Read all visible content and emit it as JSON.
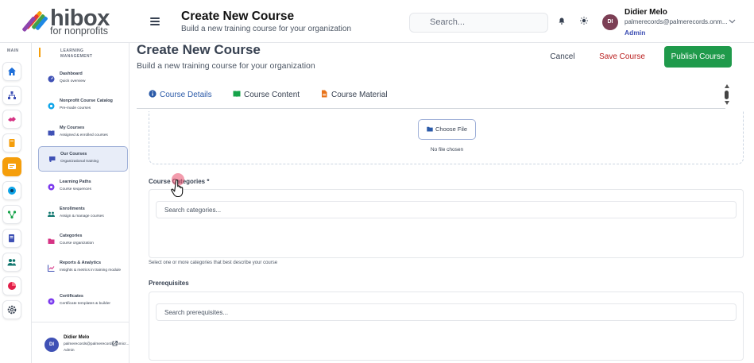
{
  "app": {
    "logo_word": "hibox",
    "logo_sub": "for nonprofits"
  },
  "header": {
    "title": "Create New Course",
    "subtitle": "Build a new training course for your organization",
    "search_placeholder": "Search...",
    "user": {
      "initials": "DI",
      "name": "Didier Melo",
      "email": "palmerecords@palmerecords.onm...",
      "role": "Admin"
    }
  },
  "rail": {
    "label": "MAIN"
  },
  "menu": {
    "label_line1": "LEARNING",
    "label_line2": "MANAGEMENT",
    "items": [
      {
        "title": "Dashboard",
        "desc": "Quick overview"
      },
      {
        "title": "Nonprofit Course Catalog",
        "desc": "Pre-made courses"
      },
      {
        "title": "My Courses",
        "desc": "Assigned & enrolled courses"
      },
      {
        "title": "Our Courses",
        "desc": "Organizational training"
      },
      {
        "title": "Learning Paths",
        "desc": "Course sequences"
      },
      {
        "title": "Enrollments",
        "desc": "Assign & manage courses"
      },
      {
        "title": "Categories",
        "desc": "Course organization"
      },
      {
        "title": "Reports & Analytics",
        "desc": "Insights & metrics in training module"
      },
      {
        "title": "Certificates",
        "desc": "Certificate templates & builder"
      }
    ],
    "footer": {
      "initials": "DI",
      "name": "Didier Melo",
      "email": "palmerecords@palmerecords.onmicr...",
      "role": "Admin"
    }
  },
  "page": {
    "title": "Create New Course",
    "subtitle": "Build a new training course for your organization",
    "actions": {
      "cancel": "Cancel",
      "save": "Save Course",
      "publish": "Publish Course"
    },
    "tabs": [
      {
        "label": "Course Details"
      },
      {
        "label": "Course Content"
      },
      {
        "label": "Course Material"
      }
    ],
    "upload": {
      "button": "Choose File",
      "status": "No file chosen"
    },
    "categories": {
      "label": "Course Categories *",
      "placeholder": "Search categories...",
      "hint": "Select one or more categories that best describe your course"
    },
    "prerequisites": {
      "label": "Prerequisites",
      "placeholder": "Search prerequisites..."
    }
  },
  "colors": {
    "accent": "#f59e0b",
    "primary": "#2b5aa8",
    "publish": "#1f9a4b",
    "save": "#b91c1c"
  }
}
